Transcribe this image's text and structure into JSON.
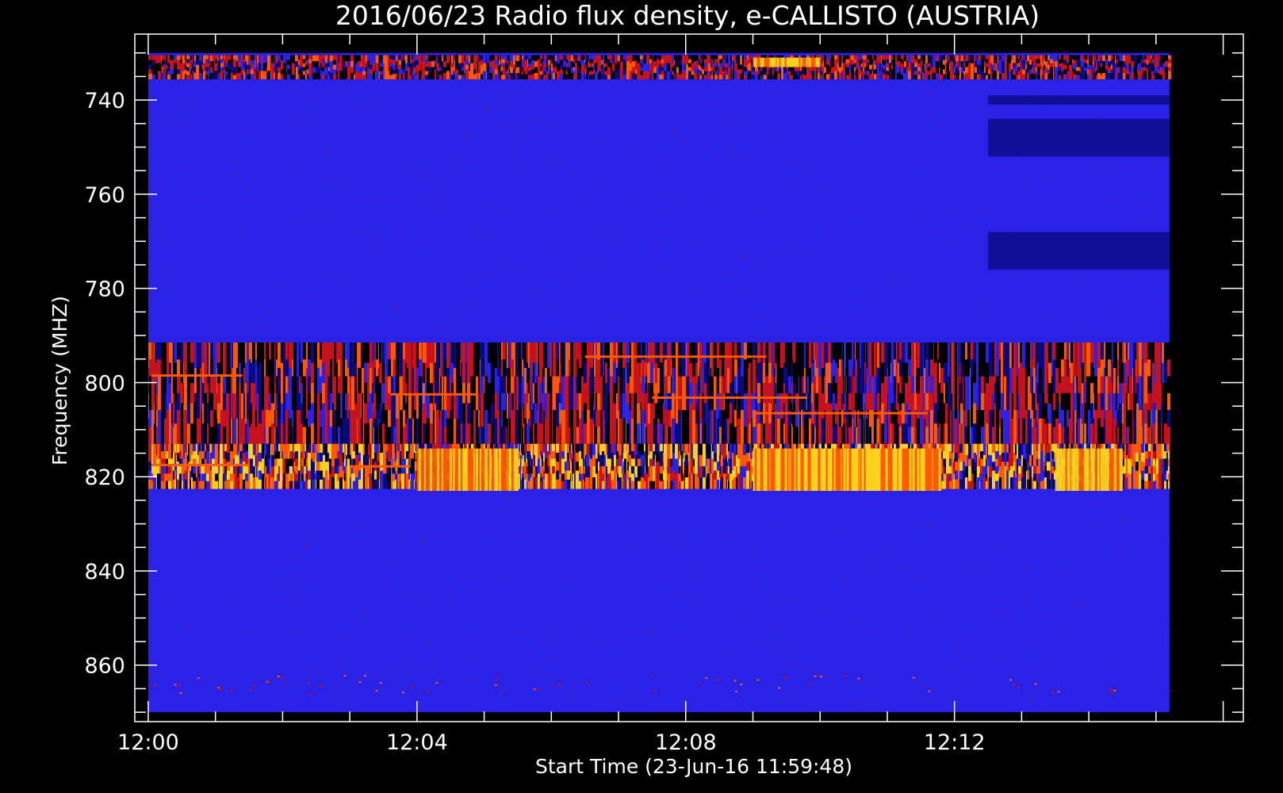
{
  "chart_data": {
    "type": "heatmap",
    "title": "2016/06/23  Radio flux density, e-CALLISTO (AUSTRIA)",
    "xlabel": "Start Time (23-Jun-16 11:59:48)",
    "ylabel": "Frequency (MHZ)",
    "x_ticks": [
      "12:00",
      "12:04",
      "12:08",
      "12:12"
    ],
    "y_ticks": [
      740,
      760,
      780,
      800,
      820,
      840,
      860
    ],
    "x_range_minutes": [
      11.8,
      28.3
    ],
    "data_x_range_minutes": [
      12.0,
      27.2
    ],
    "ylim": [
      726,
      872
    ],
    "y_inverted": true,
    "data_y_range": [
      730,
      870
    ],
    "colormap": [
      "#000000",
      "#0a0a80",
      "#2a22e6",
      "#c8121e",
      "#ff5a00",
      "#ffd21e"
    ],
    "background_color": "#2a22e6",
    "frame_color": "#ffffff",
    "bands": [
      {
        "from": 730.5,
        "to": 735.5,
        "intensity": "high"
      },
      {
        "from": 791.5,
        "to": 813,
        "intensity": "high"
      },
      {
        "from": 813,
        "to": 822.5,
        "intensity": "very-high"
      }
    ],
    "dark_patches": [
      {
        "t_from": 24.5,
        "t_to": 27.2,
        "f_from": 739,
        "f_to": 741
      },
      {
        "t_from": 24.5,
        "t_to": 27.2,
        "f_from": 744,
        "f_to": 752
      },
      {
        "t_from": 24.5,
        "t_to": 27.2,
        "f_from": 768,
        "f_to": 776
      }
    ],
    "bright_patches": [
      {
        "t_from": 21.0,
        "t_to": 23.8,
        "f_from": 814,
        "f_to": 823
      },
      {
        "t_from": 16.0,
        "t_to": 17.5,
        "f_from": 814,
        "f_to": 823
      },
      {
        "t_from": 25.5,
        "t_to": 26.5,
        "f_from": 814,
        "f_to": 823
      },
      {
        "t_from": 21.0,
        "t_to": 22.0,
        "f_from": 731,
        "f_to": 733
      }
    ],
    "streaks": [
      {
        "t_from": 12.05,
        "t_to": 13.4,
        "f": 798.5
      },
      {
        "t_from": 15.6,
        "t_to": 16.9,
        "f": 802.5
      },
      {
        "t_from": 19.5,
        "t_to": 21.8,
        "f": 803.2
      },
      {
        "t_from": 18.5,
        "t_to": 21.2,
        "f": 794.5
      },
      {
        "t_from": 21.0,
        "t_to": 23.6,
        "f": 806.5
      },
      {
        "t_from": 12.05,
        "t_to": 13.5,
        "f": 817.5
      },
      {
        "t_from": 15.0,
        "t_to": 15.9,
        "f": 817.8
      }
    ]
  }
}
